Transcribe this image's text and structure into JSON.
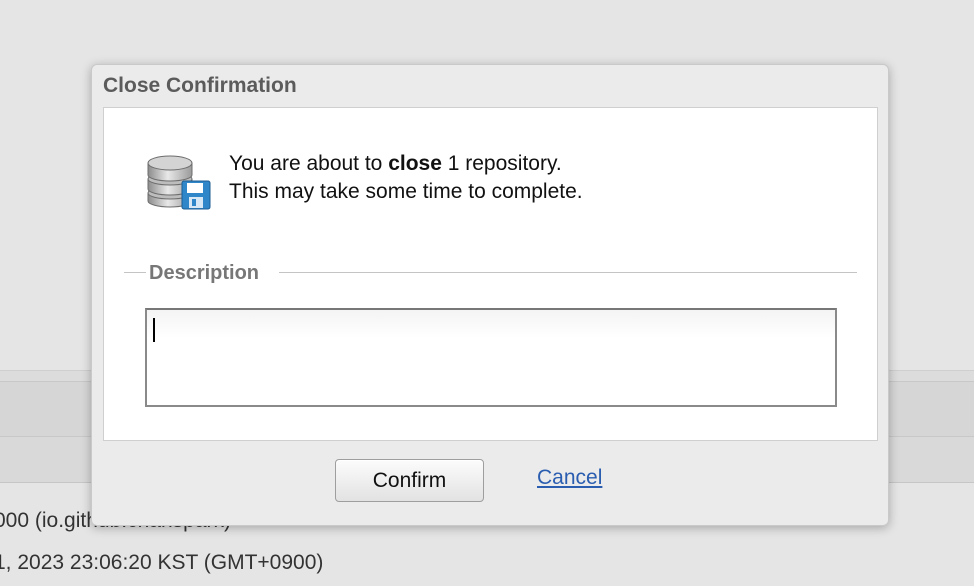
{
  "background": {
    "line1": "000 (io.github.chanspark)",
    "line2": "1, 2023 23:06:20 KST (GMT+0900)"
  },
  "dialog": {
    "title": "Close Confirmation",
    "message_pre": "You are about to ",
    "message_bold": "close",
    "message_post": " 1 repository.",
    "message_line2": "This may take some time to complete.",
    "legend": "Description",
    "description_value": "",
    "confirm_label": "Confirm",
    "cancel_label": "Cancel",
    "icon": "repository-database-save-icon"
  },
  "colors": {
    "link": "#2a5db0",
    "title_text": "#5b5b5b",
    "legend_text": "#777777"
  }
}
